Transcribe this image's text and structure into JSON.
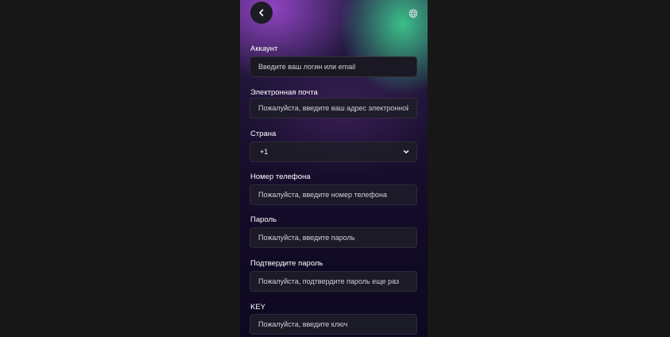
{
  "form": {
    "account": {
      "label": "Аккаунт",
      "placeholder": "Введите ваш логин или email"
    },
    "email": {
      "label": "Электронная почта",
      "placeholder": "Пожалуйста, введите ваш адрес электронной почты"
    },
    "country": {
      "label": "Страна",
      "value": "+1"
    },
    "phone": {
      "label": "Номер телефона",
      "placeholder": "Пожалуйста, введите номер телефона"
    },
    "password": {
      "label": "Пароль",
      "placeholder": "Пожалуйста, введите пароль"
    },
    "confirm_password": {
      "label": "Подтвердите пароль",
      "placeholder": "Пожалуйста, подтвердите пароль еще раз"
    },
    "key": {
      "label": "KEY",
      "placeholder": "Пожалуйста, введите ключ"
    }
  },
  "icons": {
    "back": "chevron-left-icon",
    "language": "globe-icon",
    "select": "chevron-down-icon"
  }
}
